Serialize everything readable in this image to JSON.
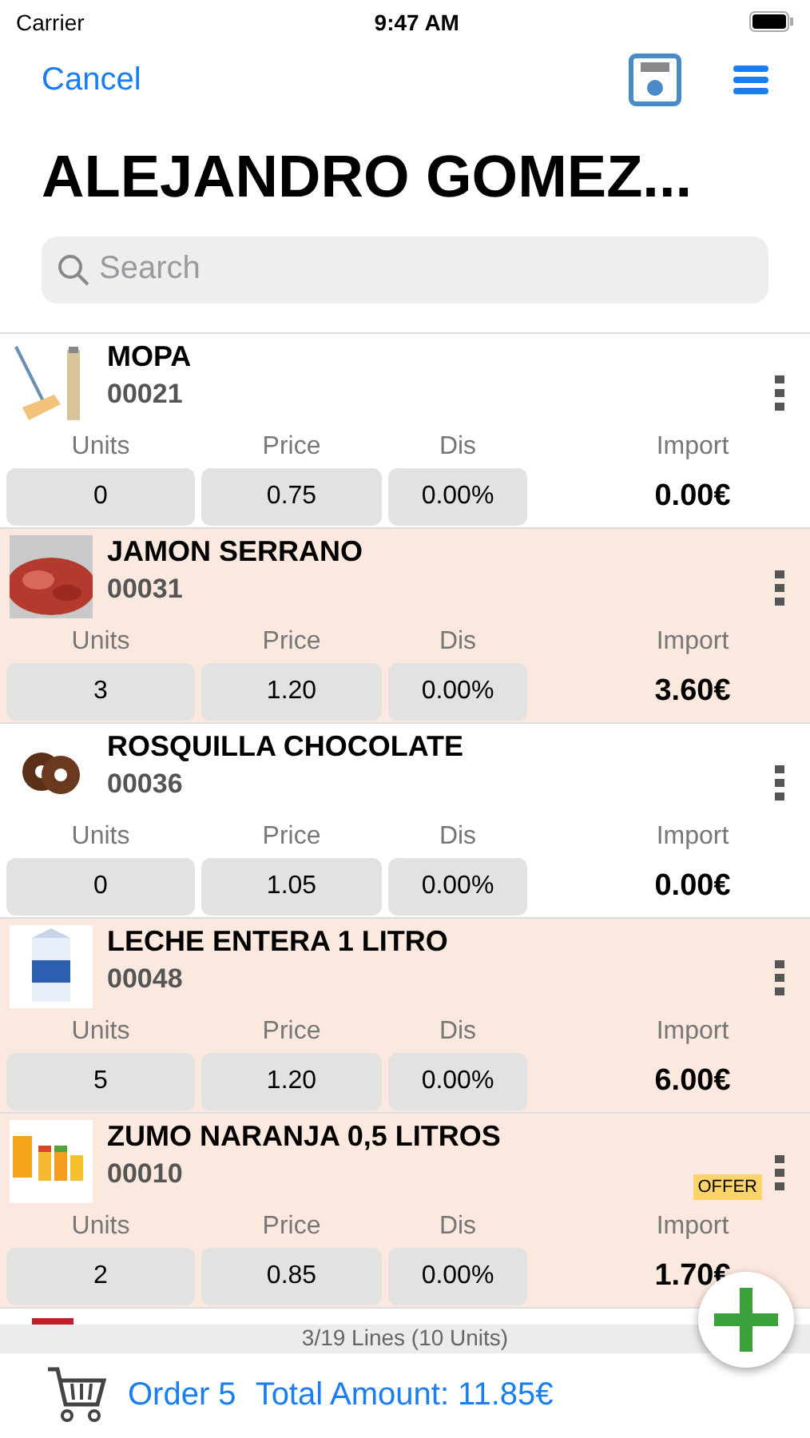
{
  "status_bar": {
    "carrier": "Carrier",
    "time": "9:47 AM"
  },
  "nav": {
    "cancel": "Cancel"
  },
  "title": "ALEJANDRO GOMEZ...",
  "search": {
    "placeholder": "Search"
  },
  "items": [
    {
      "name": "MOPA",
      "code": "00021",
      "labels": {
        "units": "Units",
        "price": "Price",
        "discount": "Dis",
        "import": "Import"
      },
      "units": "0",
      "price": "0.75",
      "discount": "0.00%",
      "import": "0.00€",
      "highlighted": false
    },
    {
      "name": "JAMON SERRANO",
      "code": "00031",
      "labels": {
        "units": "Units",
        "price": "Price",
        "discount": "Dis",
        "import": "Import"
      },
      "units": "3",
      "price": "1.20",
      "discount": "0.00%",
      "import": "3.60€",
      "highlighted": true
    },
    {
      "name": "ROSQUILLA CHOCOLATE",
      "code": "00036",
      "labels": {
        "units": "Units",
        "price": "Price",
        "discount": "Dis",
        "import": "Import"
      },
      "units": "0",
      "price": "1.05",
      "discount": "0.00%",
      "import": "0.00€",
      "highlighted": false
    },
    {
      "name": "LECHE ENTERA 1 LITRO",
      "code": "00048",
      "labels": {
        "units": "Units",
        "price": "Price",
        "discount": "Dis",
        "import": "Import"
      },
      "units": "5",
      "price": "1.20",
      "discount": "0.00%",
      "import": "6.00€",
      "highlighted": true
    },
    {
      "name": "ZUMO NARANJA 0,5 LITROS",
      "code": "00010",
      "labels": {
        "units": "Units",
        "price": "Price",
        "discount": "Dis",
        "import": "Import"
      },
      "units": "2",
      "price": "0.85",
      "discount": "0.00%",
      "import": "1.70€",
      "highlighted": true,
      "badge": "OFFER"
    }
  ],
  "summary": "3/19 Lines (10 Units)",
  "footer": {
    "order": "Order 5",
    "total": "Total Amount: 11.85€"
  }
}
